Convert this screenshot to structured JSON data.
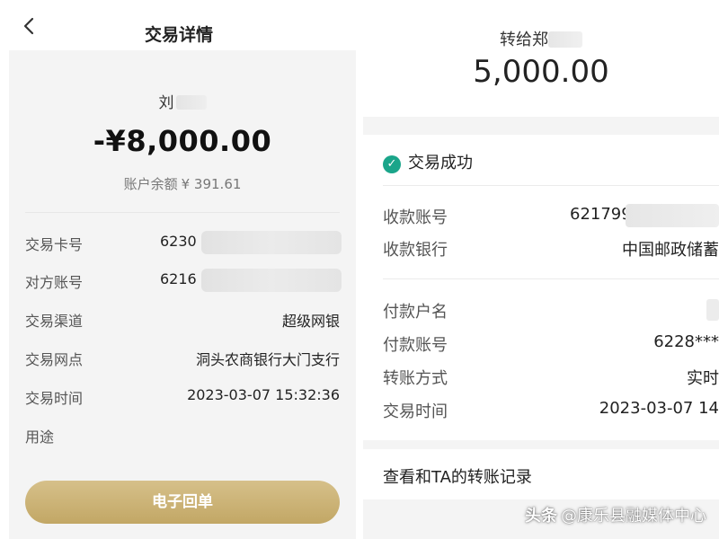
{
  "left": {
    "title": "交易详情",
    "payee": "刘",
    "amount": "-¥8,000.00",
    "balance_label": "账户余额",
    "balance_value": "¥ 391.61",
    "rows": [
      {
        "label": "交易卡号",
        "value": "6230"
      },
      {
        "label": "对方账号",
        "value": "6216"
      },
      {
        "label": "交易渠道",
        "value": "超级网银"
      },
      {
        "label": "交易网点",
        "value": "洞头农商银行大门支行"
      },
      {
        "label": "交易时间",
        "value": "2023-03-07 15:32:36"
      },
      {
        "label": "用途",
        "value": ""
      }
    ],
    "button": "电子回单"
  },
  "right": {
    "transfer_to": "转给郑",
    "amount": "5,000.00",
    "status": "交易成功",
    "status_color": "#1aa58a",
    "rows": [
      {
        "label": "收款账号",
        "value": "621799"
      },
      {
        "label": "收款银行",
        "value": "中国邮政储蓄"
      },
      {
        "label": "付款户名",
        "value": ""
      },
      {
        "label": "付款账号",
        "value": "6228***"
      },
      {
        "label": "转账方式",
        "value": "实时"
      },
      {
        "label": "交易时间",
        "value": "2023-03-07 14"
      }
    ],
    "link": "查看和TA的转账记录"
  },
  "watermark": {
    "logo": "头条",
    "text": "@康乐县融媒体中心"
  },
  "colors": {
    "button_gold": "#c9ae6f",
    "panel_bg": "#f4f4f4"
  }
}
